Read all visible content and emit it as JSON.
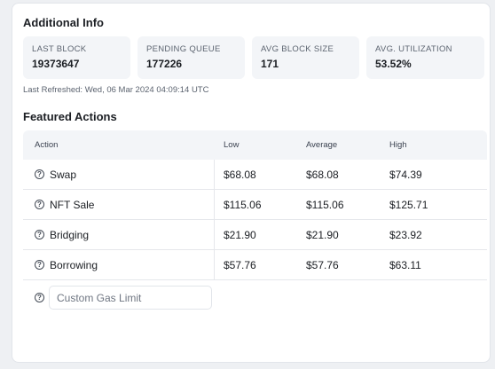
{
  "additional_info": {
    "title": "Additional Info",
    "stats": [
      {
        "label": "LAST BLOCK",
        "value": "19373647"
      },
      {
        "label": "PENDING QUEUE",
        "value": "177226"
      },
      {
        "label": "AVG BLOCK SIZE",
        "value": "171"
      },
      {
        "label": "AVG. UTILIZATION",
        "value": "53.52%"
      }
    ],
    "last_refreshed": "Last Refreshed: Wed, 06 Mar 2024 04:09:14 UTC"
  },
  "featured_actions": {
    "title": "Featured Actions",
    "columns": [
      "Action",
      "Low",
      "Average",
      "High"
    ],
    "rows": [
      {
        "action": "Swap",
        "low": "$68.08",
        "average": "$68.08",
        "high": "$74.39"
      },
      {
        "action": "NFT Sale",
        "low": "$115.06",
        "average": "$115.06",
        "high": "$125.71"
      },
      {
        "action": "Bridging",
        "low": "$21.90",
        "average": "$21.90",
        "high": "$23.92"
      },
      {
        "action": "Borrowing",
        "low": "$57.76",
        "average": "$57.76",
        "high": "$63.11"
      }
    ],
    "custom_input": {
      "placeholder": "Custom Gas Limit",
      "value": ""
    },
    "help_glyph": "?"
  }
}
